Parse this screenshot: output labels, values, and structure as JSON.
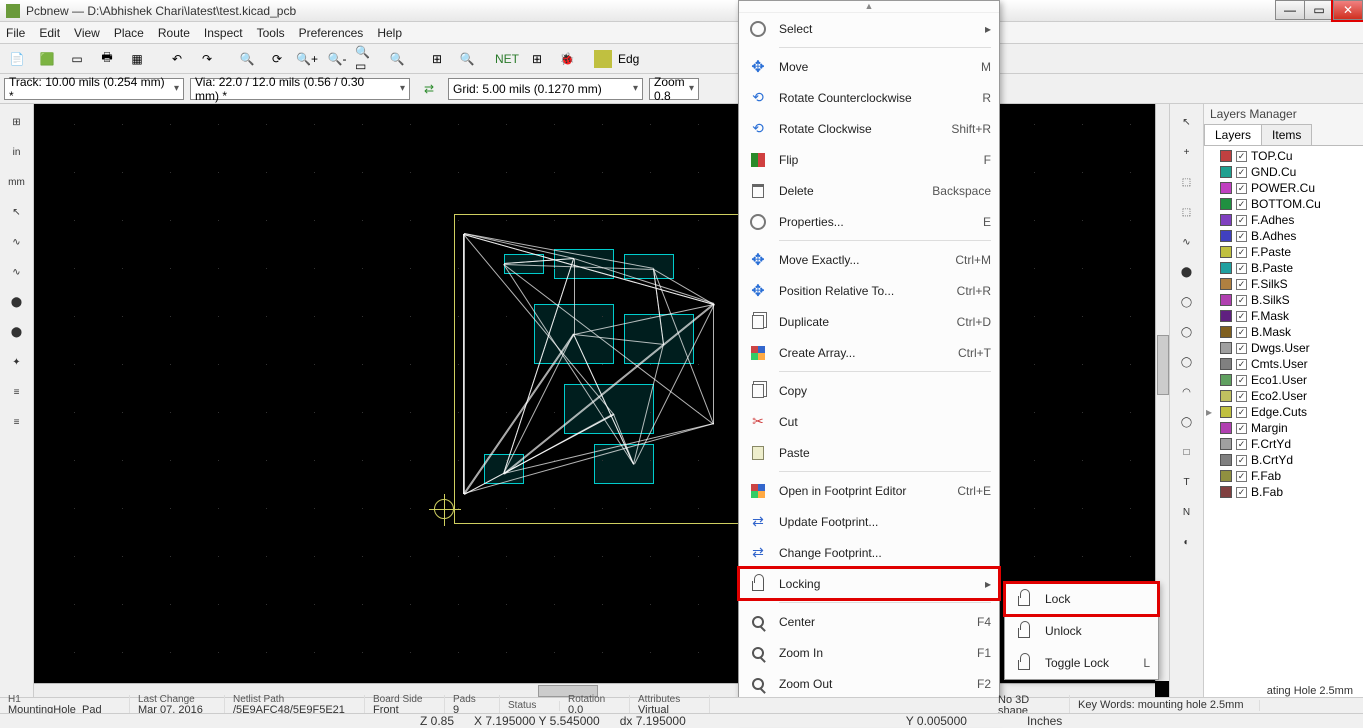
{
  "title": "Pcbnew — D:\\Abhishek Chari\\latest\\test.kicad_pcb",
  "menubar": [
    "File",
    "Edit",
    "View",
    "Place",
    "Route",
    "Inspect",
    "Tools",
    "Preferences",
    "Help"
  ],
  "toolbar2": {
    "track": "Track: 10.00 mils (0.254 mm) *",
    "via": "Via: 22.0 / 12.0 mils (0.56 / 0.30 mm) *",
    "grid": "Grid: 5.00 mils (0.1270 mm)",
    "zoom": "Zoom 0.8"
  },
  "toolbar_edge_label": "Edg",
  "left_toolbar": [
    "⊞",
    "in",
    "mm",
    "↖",
    "∿",
    "∿",
    "⬤",
    "⬤",
    "✦",
    "≡",
    "≡"
  ],
  "right_toolbar": [
    "↖",
    "+",
    "⬚",
    "⬚",
    "∿",
    "⬤",
    "◯",
    "◯",
    "◯",
    "◠",
    "◯",
    "□",
    "T",
    "N",
    "◐"
  ],
  "layers_panel": {
    "title": "Layers Manager",
    "tabs": [
      "Layers",
      "Items"
    ],
    "layers": [
      {
        "c": "#c04040",
        "n": "TOP.Cu"
      },
      {
        "c": "#20a090",
        "n": "GND.Cu"
      },
      {
        "c": "#c040c0",
        "n": "POWER.Cu"
      },
      {
        "c": "#209040",
        "n": "BOTTOM.Cu"
      },
      {
        "c": "#8040c0",
        "n": "F.Adhes"
      },
      {
        "c": "#4040c0",
        "n": "B.Adhes"
      },
      {
        "c": "#c0c040",
        "n": "F.Paste"
      },
      {
        "c": "#20a0a0",
        "n": "B.Paste"
      },
      {
        "c": "#b08040",
        "n": "F.SilkS"
      },
      {
        "c": "#b040b0",
        "n": "B.SilkS"
      },
      {
        "c": "#602080",
        "n": "F.Mask"
      },
      {
        "c": "#806020",
        "n": "B.Mask"
      },
      {
        "c": "#a0a0a0",
        "n": "Dwgs.User"
      },
      {
        "c": "#808080",
        "n": "Cmts.User"
      },
      {
        "c": "#60a060",
        "n": "Eco1.User"
      },
      {
        "c": "#c0c060",
        "n": "Eco2.User"
      },
      {
        "c": "#c0c040",
        "n": "Edge.Cuts",
        "sel": true
      },
      {
        "c": "#b040b0",
        "n": "Margin"
      },
      {
        "c": "#a0a0a0",
        "n": "F.CrtYd"
      },
      {
        "c": "#808080",
        "n": "B.CrtYd"
      },
      {
        "c": "#909040",
        "n": "F.Fab"
      },
      {
        "c": "#804040",
        "n": "B.Fab"
      }
    ]
  },
  "context_menu": [
    {
      "type": "item",
      "icon": "gear",
      "label": "Select",
      "sub": true
    },
    {
      "type": "sep"
    },
    {
      "type": "item",
      "icon": "move",
      "label": "Move",
      "sc": "M"
    },
    {
      "type": "item",
      "icon": "rot",
      "label": "Rotate Counterclockwise",
      "sc": "R"
    },
    {
      "type": "item",
      "icon": "rot",
      "label": "Rotate Clockwise",
      "sc": "Shift+R"
    },
    {
      "type": "item",
      "icon": "flip",
      "label": "Flip",
      "sc": "F"
    },
    {
      "type": "item",
      "icon": "trash",
      "label": "Delete",
      "sc": "Backspace"
    },
    {
      "type": "item",
      "icon": "gear",
      "label": "Properties...",
      "sc": "E"
    },
    {
      "type": "sep"
    },
    {
      "type": "item",
      "icon": "move",
      "label": "Move Exactly...",
      "sc": "Ctrl+M"
    },
    {
      "type": "item",
      "icon": "move",
      "label": "Position Relative To...",
      "sc": "Ctrl+R"
    },
    {
      "type": "item",
      "icon": "copy",
      "label": "Duplicate",
      "sc": "Ctrl+D"
    },
    {
      "type": "item",
      "icon": "grid",
      "label": "Create Array...",
      "sc": "Ctrl+T"
    },
    {
      "type": "sep"
    },
    {
      "type": "item",
      "icon": "copy",
      "label": "Copy"
    },
    {
      "type": "item",
      "icon": "cut",
      "label": "Cut"
    },
    {
      "type": "item",
      "icon": "paste",
      "label": "Paste"
    },
    {
      "type": "sep"
    },
    {
      "type": "item",
      "icon": "grid",
      "label": "Open in Footprint Editor",
      "sc": "Ctrl+E"
    },
    {
      "type": "item",
      "icon": "swap",
      "label": "Update Footprint..."
    },
    {
      "type": "item",
      "icon": "swap",
      "label": "Change Footprint..."
    },
    {
      "type": "item",
      "icon": "lock",
      "label": "Locking",
      "sub": true,
      "red": true
    },
    {
      "type": "sep"
    },
    {
      "type": "item",
      "icon": "mag",
      "label": "Center",
      "sc": "F4"
    },
    {
      "type": "item",
      "icon": "mag",
      "label": "Zoom In",
      "sc": "F1"
    },
    {
      "type": "item",
      "icon": "mag",
      "label": "Zoom Out",
      "sc": "F2"
    }
  ],
  "submenu": [
    {
      "icon": "lock",
      "label": "Lock",
      "red": true
    },
    {
      "icon": "lock",
      "label": "Unlock"
    },
    {
      "icon": "lock",
      "label": "Toggle Lock",
      "sc": "L"
    }
  ],
  "status1": {
    "h1_l1": "H1",
    "h1_l2": "MountingHole_Pad",
    "lc_l1": "Last Change",
    "lc_l2": "Mar 07, 2016",
    "np_l1": "Netlist Path",
    "np_l2": "/5E9AFC48/5E9F5E21",
    "bs_l1": "Board Side",
    "bs_l2": "Front",
    "pd_l1": "Pads",
    "pd_l2": "9",
    "st_l1": "Status",
    "st_l2": "",
    "rt_l1": "Rotation",
    "rt_l2": "0.0",
    "at_l1": "Attributes",
    "at_l2": "Virtual",
    "n3_l2": "No 3D shape",
    "kw_l1": "Key Words: mounting hole 2.5mm",
    "desc": "ating Hole 2.5mm"
  },
  "status2": {
    "z": "Z 0.85",
    "xy": "X 7.195000  Y 5.545000",
    "dx": "dx 7.195000",
    "dy": "Y 0.005000",
    "units": "Inches"
  }
}
